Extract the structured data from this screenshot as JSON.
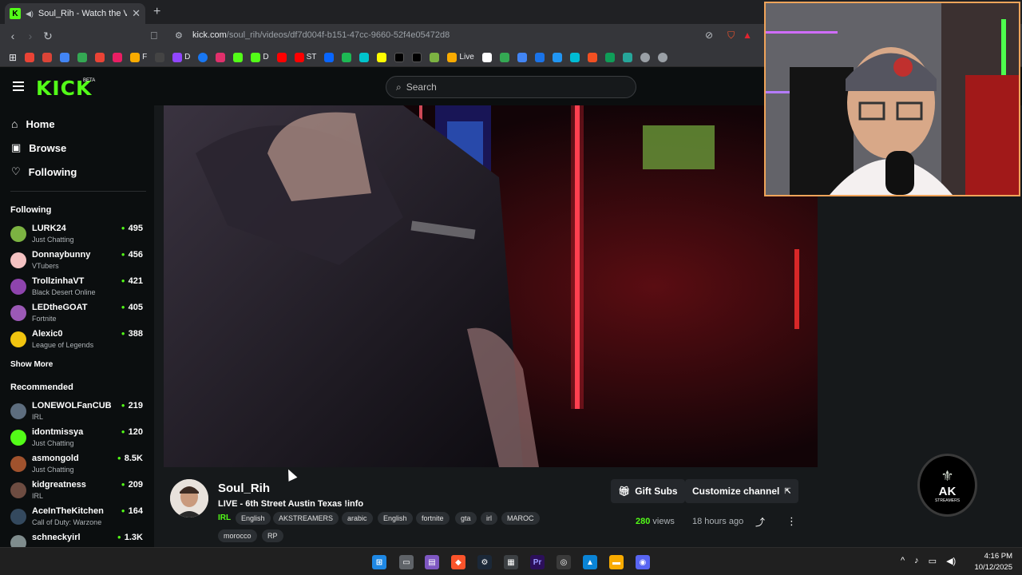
{
  "browser": {
    "tab_title": "Soul_Rih - Watch the VOD on",
    "url_main": "kick.com",
    "url_path": "/soul_rih/videos/df7d004f-b151-47cc-9660-52f4e05472d8",
    "bookmarks": [
      "F",
      "D",
      "D",
      "ST",
      "Live"
    ]
  },
  "kick": {
    "logo": "KICK",
    "beta": "BETA",
    "search_placeholder": "Search"
  },
  "sidebar": {
    "nav": [
      {
        "label": "Home",
        "icon": "home-icon"
      },
      {
        "label": "Browse",
        "icon": "browse-icon"
      },
      {
        "label": "Following",
        "icon": "heart-icon"
      }
    ],
    "following_title": "Following",
    "following": [
      {
        "name": "LURK24",
        "category": "Just Chatting",
        "viewers": "495",
        "color": "#7cb342"
      },
      {
        "name": "Donnaybunny",
        "category": "VTubers",
        "viewers": "456",
        "color": "#f4c2c2"
      },
      {
        "name": "TrollzinhaVT",
        "category": "Black Desert Online",
        "viewers": "421",
        "color": "#8e44ad"
      },
      {
        "name": "LEDtheGOAT",
        "category": "Fortnite",
        "viewers": "405",
        "color": "#9b59b6"
      },
      {
        "name": "Alexic0",
        "category": "League of Legends",
        "viewers": "388",
        "color": "#f1c40f"
      }
    ],
    "show_more": "Show More",
    "recommended_title": "Recommended",
    "recommended": [
      {
        "name": "LONEWOLFanCUB",
        "category": "IRL",
        "viewers": "219",
        "color": "#5d6d7e"
      },
      {
        "name": "idontmissya",
        "category": "Just Chatting",
        "viewers": "120",
        "color": "#53fc18"
      },
      {
        "name": "asmongold",
        "category": "Just Chatting",
        "viewers": "8.5K",
        "color": "#a0522d"
      },
      {
        "name": "kidgreatness",
        "category": "IRL",
        "viewers": "209",
        "color": "#6d4c41"
      },
      {
        "name": "AceInTheKitchen",
        "category": "Call of Duty: Warzone",
        "viewers": "164",
        "color": "#34495e"
      },
      {
        "name": "schneckyirl",
        "category": "",
        "viewers": "1.3K",
        "color": "#7f8c8d"
      }
    ]
  },
  "channel": {
    "name": "Soul_Rih",
    "title": "LIVE - 6th Street Austin Texas !info",
    "category": "IRL",
    "tags": [
      "English",
      "AKSTREAMERS",
      "arabic",
      "English",
      "fortnite",
      "gta",
      "irl",
      "MAROC",
      "morocco",
      "RP"
    ],
    "gift_subs": "Gift Subs",
    "customize": "Customize channel",
    "views_count": "280",
    "views_label": "views",
    "ago": "18 hours ago"
  },
  "ak_logo": {
    "line1": "AK",
    "line2": "STREAMERS"
  },
  "taskbar": {
    "time": "4:16 PM",
    "date": "10/12/2025"
  }
}
